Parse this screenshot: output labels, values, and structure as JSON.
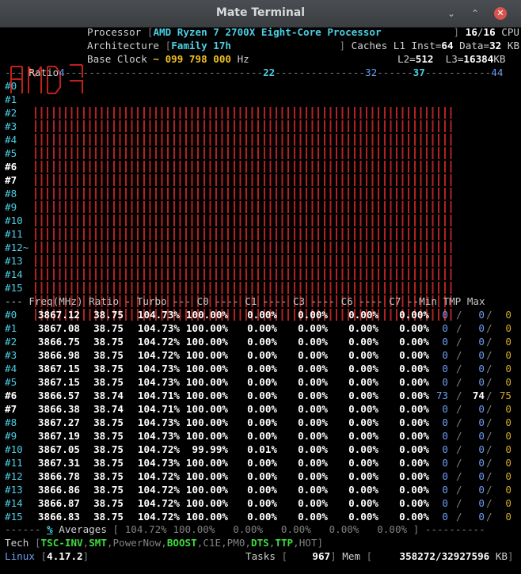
{
  "window": {
    "title": "Mate Terminal"
  },
  "header": {
    "processor_label": "Processor",
    "processor_value": "AMD Ryzen 7 2700X Eight-Core Processor",
    "cpu_count": "16",
    "cpu_total": "16",
    "cpu_label": "CPU",
    "architecture_label": "Architecture",
    "architecture_value": "Family 17h",
    "caches_label": "Caches L1 Inst=",
    "l1_inst": "64",
    "data_label": "Data=",
    "l1_data": "32",
    "kb": "KB",
    "base_clock_label": "Base Clock",
    "base_clock_value": "~ 099 798 000",
    "hz": "Hz",
    "l2_label": "L2=",
    "l2_value": "512",
    "l3_label": "L3=",
    "l3_value": "16384",
    "l3_unit": "KB"
  },
  "ratio_scale": {
    "label": "Ratio",
    "marks": [
      "4",
      "22",
      "32",
      "37",
      "44"
    ]
  },
  "bar_rows": [
    "#0",
    "#1",
    "#2",
    "#3",
    "#4",
    "#5",
    "#6",
    "#7",
    "#8",
    "#9",
    "#10",
    "#11",
    "#12~",
    "#13",
    "#14",
    "#15"
  ],
  "table": {
    "header": "--- Freq(MHz) Ratio - Turbo --- C0 ---- C1 ---- C3 ---- C6 ---- C7 --Min TMP Max",
    "rows": [
      {
        "id": "#0",
        "freq": "3867.12",
        "ratio": "38.75",
        "turbo": "104.73%",
        "c0": "100.00%",
        "c1": "0.00%",
        "c3": "0.00%",
        "c6": "0.00%",
        "c7": "0.00%",
        "min": "0",
        "tmp": "0",
        "max": "0"
      },
      {
        "id": "#1",
        "freq": "3867.08",
        "ratio": "38.75",
        "turbo": "104.73%",
        "c0": "100.00%",
        "c1": "0.00%",
        "c3": "0.00%",
        "c6": "0.00%",
        "c7": "0.00%",
        "min": "0",
        "tmp": "0",
        "max": "0"
      },
      {
        "id": "#2",
        "freq": "3866.75",
        "ratio": "38.75",
        "turbo": "104.72%",
        "c0": "100.00%",
        "c1": "0.00%",
        "c3": "0.00%",
        "c6": "0.00%",
        "c7": "0.00%",
        "min": "0",
        "tmp": "0",
        "max": "0"
      },
      {
        "id": "#3",
        "freq": "3866.98",
        "ratio": "38.75",
        "turbo": "104.72%",
        "c0": "100.00%",
        "c1": "0.00%",
        "c3": "0.00%",
        "c6": "0.00%",
        "c7": "0.00%",
        "min": "0",
        "tmp": "0",
        "max": "0"
      },
      {
        "id": "#4",
        "freq": "3867.15",
        "ratio": "38.75",
        "turbo": "104.73%",
        "c0": "100.00%",
        "c1": "0.00%",
        "c3": "0.00%",
        "c6": "0.00%",
        "c7": "0.00%",
        "min": "0",
        "tmp": "0",
        "max": "0"
      },
      {
        "id": "#5",
        "freq": "3867.15",
        "ratio": "38.75",
        "turbo": "104.73%",
        "c0": "100.00%",
        "c1": "0.00%",
        "c3": "0.00%",
        "c6": "0.00%",
        "c7": "0.00%",
        "min": "0",
        "tmp": "0",
        "max": "0"
      },
      {
        "id": "#6",
        "freq": "3866.57",
        "ratio": "38.74",
        "turbo": "104.71%",
        "c0": "100.00%",
        "c1": "0.00%",
        "c3": "0.00%",
        "c6": "0.00%",
        "c7": "0.00%",
        "min": "73",
        "tmp": "74",
        "max": "75"
      },
      {
        "id": "#7",
        "freq": "3866.38",
        "ratio": "38.74",
        "turbo": "104.71%",
        "c0": "100.00%",
        "c1": "0.00%",
        "c3": "0.00%",
        "c6": "0.00%",
        "c7": "0.00%",
        "min": "0",
        "tmp": "0",
        "max": "0"
      },
      {
        "id": "#8",
        "freq": "3867.27",
        "ratio": "38.75",
        "turbo": "104.73%",
        "c0": "100.00%",
        "c1": "0.00%",
        "c3": "0.00%",
        "c6": "0.00%",
        "c7": "0.00%",
        "min": "0",
        "tmp": "0",
        "max": "0"
      },
      {
        "id": "#9",
        "freq": "3867.19",
        "ratio": "38.75",
        "turbo": "104.73%",
        "c0": "100.00%",
        "c1": "0.00%",
        "c3": "0.00%",
        "c6": "0.00%",
        "c7": "0.00%",
        "min": "0",
        "tmp": "0",
        "max": "0"
      },
      {
        "id": "#10",
        "freq": "3867.05",
        "ratio": "38.75",
        "turbo": "104.72%",
        "c0": "99.99%",
        "c1": "0.01%",
        "c3": "0.00%",
        "c6": "0.00%",
        "c7": "0.00%",
        "min": "0",
        "tmp": "0",
        "max": "0"
      },
      {
        "id": "#11",
        "freq": "3867.31",
        "ratio": "38.75",
        "turbo": "104.73%",
        "c0": "100.00%",
        "c1": "0.00%",
        "c3": "0.00%",
        "c6": "0.00%",
        "c7": "0.00%",
        "min": "0",
        "tmp": "0",
        "max": "0"
      },
      {
        "id": "#12",
        "freq": "3866.78",
        "ratio": "38.75",
        "turbo": "104.72%",
        "c0": "100.00%",
        "c1": "0.00%",
        "c3": "0.00%",
        "c6": "0.00%",
        "c7": "0.00%",
        "min": "0",
        "tmp": "0",
        "max": "0"
      },
      {
        "id": "#13",
        "freq": "3866.86",
        "ratio": "38.75",
        "turbo": "104.72%",
        "c0": "100.00%",
        "c1": "0.00%",
        "c3": "0.00%",
        "c6": "0.00%",
        "c7": "0.00%",
        "min": "0",
        "tmp": "0",
        "max": "0"
      },
      {
        "id": "#14",
        "freq": "3866.87",
        "ratio": "38.75",
        "turbo": "104.72%",
        "c0": "100.00%",
        "c1": "0.00%",
        "c3": "0.00%",
        "c6": "0.00%",
        "c7": "0.00%",
        "min": "0",
        "tmp": "0",
        "max": "0"
      },
      {
        "id": "#15",
        "freq": "3866.83",
        "ratio": "38.75",
        "turbo": "104.72%",
        "c0": "100.00%",
        "c1": "0.00%",
        "c3": "0.00%",
        "c6": "0.00%",
        "c7": "0.00%",
        "min": "0",
        "tmp": "0",
        "max": "0"
      }
    ],
    "averages": {
      "pct": "%",
      "label": "Averages",
      "turbo": "104.72%",
      "c0": "100.00%",
      "c1": "0.00%",
      "c3": "0.00%",
      "c6": "0.00%",
      "c7": "0.00%"
    }
  },
  "footer": {
    "tech_label": "Tech",
    "tech_items": [
      {
        "label": "TSC-INV",
        "active": true
      },
      {
        "label": "SMT",
        "active": true
      },
      {
        "label": "PowerNow",
        "active": false
      },
      {
        "label": "BOOST",
        "active": true
      },
      {
        "label": "C1E",
        "active": false
      },
      {
        "label": "PM0",
        "active": false
      },
      {
        "label": "DTS",
        "active": true
      },
      {
        "label": "TTP",
        "active": true
      },
      {
        "label": "HOT",
        "active": false
      }
    ],
    "os_label": "Linux",
    "kernel": "4.17.2",
    "tasks_label": "Tasks",
    "tasks_value": "967",
    "mem_label": "Mem",
    "mem_value": "358272/32927596",
    "mem_unit": "KB"
  }
}
